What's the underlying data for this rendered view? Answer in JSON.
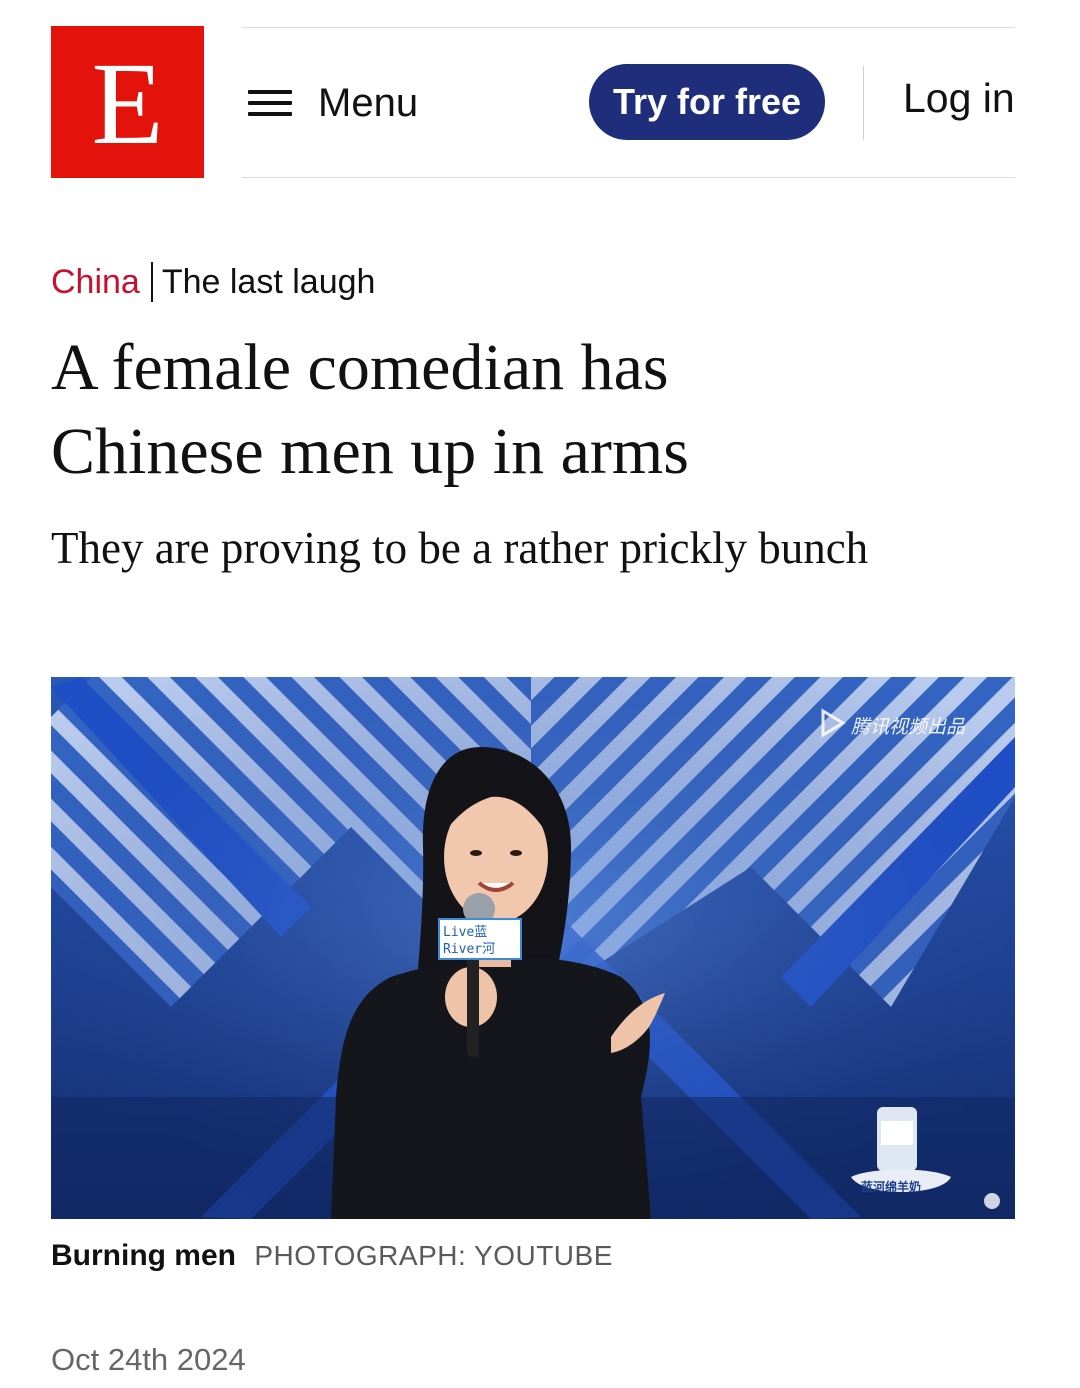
{
  "header": {
    "logo_letter": "E",
    "menu_label": "Menu",
    "try_label": "Try for free",
    "login_label": "Log in",
    "brand_color": "#e3120b",
    "button_color": "#1f2e7a"
  },
  "article": {
    "section": "China",
    "flytitle": "The last laugh",
    "headline_line1": "A female comedian has",
    "headline_line2": "Chinese men up in arms",
    "subheadline": "They are proving to be a rather prickly bunch",
    "image": {
      "watermark": "腾讯视频出品",
      "mic_flag_top": "Live蓝",
      "mic_flag_bottom": "River河",
      "product_label": "蓝河绵羊奶"
    },
    "caption_title": "Burning men",
    "caption_credit": "PHOTOGRAPH: YOUTUBE",
    "date": "Oct 24th 2024",
    "section_color": "#c8102e"
  }
}
